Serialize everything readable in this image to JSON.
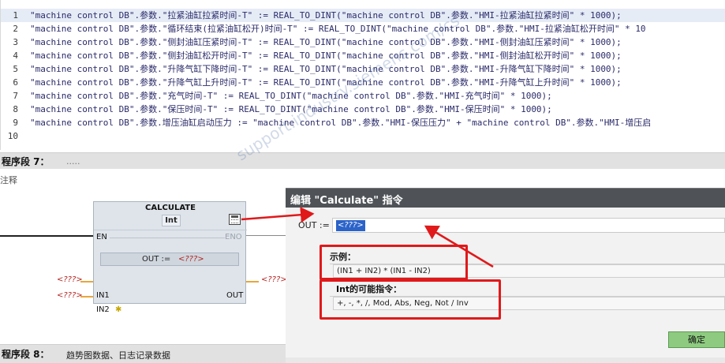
{
  "code": {
    "lines": [
      {
        "no": "1",
        "text": "\"machine control DB\".参数.\"拉紧油缸拉紧时间-T\" := REAL_TO_DINT(\"machine control DB\".参数.\"HMI-拉紧油缸拉紧时间\" * 1000);"
      },
      {
        "no": "2",
        "text": "\"machine control DB\".参数.\"循环结束(拉紧油缸松开)时间-T\" := REAL_TO_DINT(\"machine control DB\".参数.\"HMI-拉紧油缸松开时间\" * 10"
      },
      {
        "no": "3",
        "text": "\"machine control DB\".参数.\"侧封油缸压紧时间-T\" := REAL_TO_DINT(\"machine control DB\".参数.\"HMI-侧封油缸压紧时间\" * 1000);"
      },
      {
        "no": "4",
        "text": "\"machine control DB\".参数.\"侧封油缸松开时间-T\" := REAL_TO_DINT(\"machine control DB\".参数.\"HMI-侧封油缸松开时间\" * 1000);"
      },
      {
        "no": "5",
        "text": "\"machine control DB\".参数.\"升降气缸下降时间-T\" := REAL_TO_DINT(\"machine control DB\".参数.\"HMI-升降气缸下降时间\" * 1000);"
      },
      {
        "no": "6",
        "text": "\"machine control DB\".参数.\"升降气缸上升时间-T\" := REAL_TO_DINT(\"machine control DB\".参数.\"HMI-升降气缸上升时间\" * 1000);"
      },
      {
        "no": "7",
        "text": "\"machine control DB\".参数.\"充气时间-T\" := REAL_TO_DINT(\"machine control DB\".参数.\"HMI-充气时间\" * 1000);"
      },
      {
        "no": "8",
        "text": "\"machine control DB\".参数.\"保压时间-T\" := REAL_TO_DINT(\"machine control DB\".参数.\"HMI-保压时间\" * 1000);"
      },
      {
        "no": "9",
        "text": "\"machine control DB\".参数.增压油缸启动压力 := \"machine control DB\".参数.\"HMI-保压压力\" + \"machine control DB\".参数.\"HMI-增压启"
      },
      {
        "no": "10",
        "text": ""
      }
    ]
  },
  "network7": {
    "title": "程序段 7：",
    "description": "....."
  },
  "comment_label": "注释",
  "block": {
    "name": "CALCULATE",
    "type": "Int",
    "en": "EN",
    "eno": "ENO",
    "out_field_label": "OUT :=",
    "out_field_value": "<???>",
    "in1": "IN1",
    "in2": "IN2",
    "out": "OUT",
    "in1_operand": "<???>",
    "in2_operand": "<???>",
    "out_operand": "<???>",
    "calc_icon": "calculator-icon",
    "star_icon": "add-input-star-icon"
  },
  "network8": {
    "title": "程序段 8：",
    "description": "趋势图数据、日志记录数据"
  },
  "dialog": {
    "title": "编辑 \"Calculate\" 指令",
    "out_label": "OUT :=",
    "out_value": "<???>",
    "example_title": "示例：",
    "example_text": "(IN1 + IN2) * (IN1 - IN2)",
    "instructions_title": "Int的可能指令：",
    "instructions_text": "+, -, *, /, Mod, Abs, Neg, Not / Inv",
    "ok_label": "确定"
  },
  "watermark": "support.industry.siemens.com/cs",
  "colors": {
    "annotation_red": "#e0191b",
    "operand_red": "#b2221f",
    "ok_green": "#8ecb80",
    "selection_blue": "#2b63c9"
  }
}
